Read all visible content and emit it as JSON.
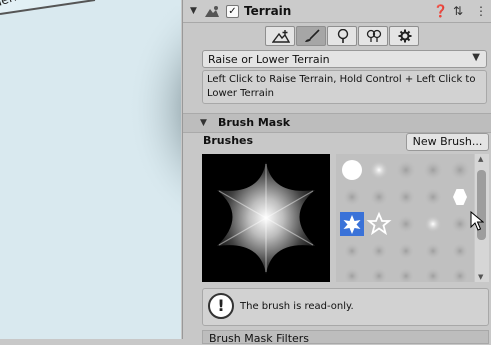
{
  "scene": {
    "label": "Terrain"
  },
  "header": {
    "title": "Terrain",
    "enabled": true
  },
  "header_icons": [
    "terrain-icon",
    "help-icon",
    "presets-icon",
    "more-icon"
  ],
  "toolbar": {
    "tools": [
      {
        "name": "create-neighbor-terrains-icon"
      },
      {
        "name": "paint-terrain-icon",
        "active": true
      },
      {
        "name": "paint-trees-icon"
      },
      {
        "name": "paint-details-icon"
      },
      {
        "name": "terrain-settings-icon"
      }
    ]
  },
  "tool_dropdown": {
    "value": "Raise or Lower Terrain"
  },
  "help": {
    "text": "Left Click to Raise Terrain, Hold Control + Left Click to Lower Terrain"
  },
  "brush_mask": {
    "section_label": "Brush Mask"
  },
  "brushes": {
    "label": "Brushes",
    "new_button": "New Brush..."
  },
  "brush_grid": {
    "rows": 5,
    "cols": 5,
    "selected_index": 10
  },
  "info": {
    "text": "The brush is read-only."
  },
  "filters": {
    "label": "Brush Mask Filters"
  },
  "colors": {
    "selected": "#3a72d8",
    "panel": "#c8c8c8",
    "scene": "#d8e7ee"
  }
}
